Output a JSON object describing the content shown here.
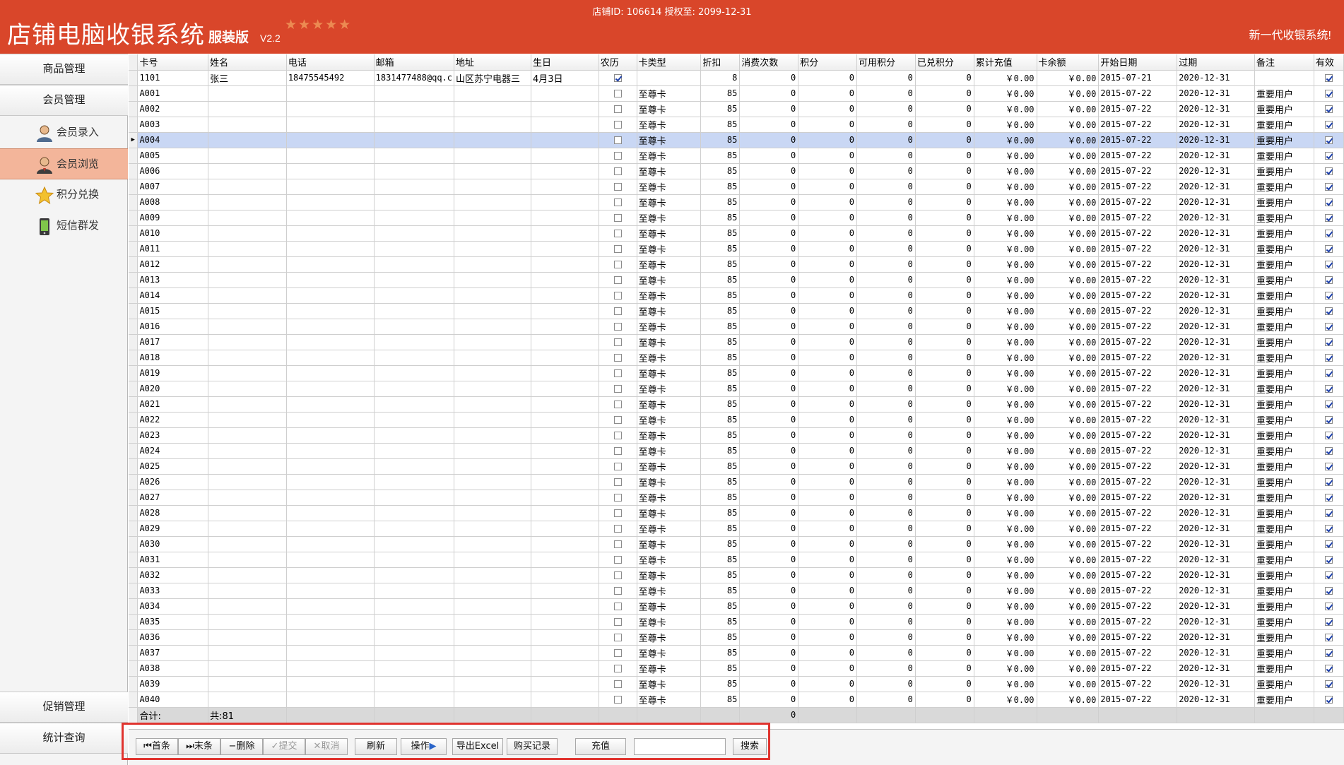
{
  "titlebar": {
    "app_title": "店铺电脑收银系统",
    "edition": "服装版",
    "version": "V2.2",
    "stars": "★★★★★",
    "shop_info": "店铺ID: 106614 授权至: 2099-12-31",
    "slogan": "新一代收银系统!"
  },
  "sidebar": {
    "goods": "商品管理",
    "member": "会员管理",
    "sub_items": [
      "会员录入",
      "会员浏览",
      "积分兑换",
      "短信群发"
    ],
    "promo": "促销管理",
    "stats": "统计查询"
  },
  "grid": {
    "columns": [
      "卡号",
      "姓名",
      "电话",
      "邮箱",
      "地址",
      "生日",
      "农历",
      "卡类型",
      "折扣",
      "消费次数",
      "积分",
      "可用积分",
      "已兑积分",
      "累计充值",
      "卡余额",
      "开始日期",
      "过期",
      "备注",
      "有效"
    ],
    "first_row": {
      "card": "1101",
      "name": "张三",
      "phone": "18475545492",
      "email": "1831477488@qq.c",
      "address": "山区苏宁电器三",
      "birthday": "4月3日",
      "lunar": true,
      "card_type": "",
      "discount": "8",
      "count": "0",
      "points": "0",
      "avail": "0",
      "redeemed": "0",
      "total": "￥0.00",
      "balance": "￥0.00",
      "start": "2015-07-21",
      "expire": "2020-12-31",
      "note": "",
      "valid": true
    },
    "default_row": {
      "card_type": "至尊卡",
      "discount": "85",
      "count": "0",
      "points": "0",
      "avail": "0",
      "redeemed": "0",
      "total": "￥0.00",
      "balance": "￥0.00",
      "start": "2015-07-22",
      "expire": "2020-12-31",
      "note": "重要用户",
      "valid": true
    },
    "card_numbers": [
      "A001",
      "A002",
      "A003",
      "A004",
      "A005",
      "A006",
      "A007",
      "A008",
      "A009",
      "A010",
      "A011",
      "A012",
      "A013",
      "A014",
      "A015",
      "A016",
      "A017",
      "A018",
      "A019",
      "A020",
      "A021",
      "A022",
      "A023",
      "A024",
      "A025",
      "A026",
      "A027",
      "A028",
      "A029",
      "A030",
      "A031",
      "A032",
      "A033",
      "A034",
      "A035",
      "A036",
      "A037",
      "A038",
      "A039",
      "A040"
    ],
    "selected_card": "A004",
    "summary_label": "合计:",
    "summary_count": "共:81",
    "summary_count_total": "0"
  },
  "toolbar": {
    "first": "首条",
    "last": "末条",
    "delete": "删除",
    "submit": "提交",
    "cancel": "取消",
    "refresh": "刷新",
    "operate": "操作",
    "export": "导出Excel",
    "purchase": "购买记录",
    "recharge": "充值",
    "search_value": "",
    "search": "搜索"
  }
}
